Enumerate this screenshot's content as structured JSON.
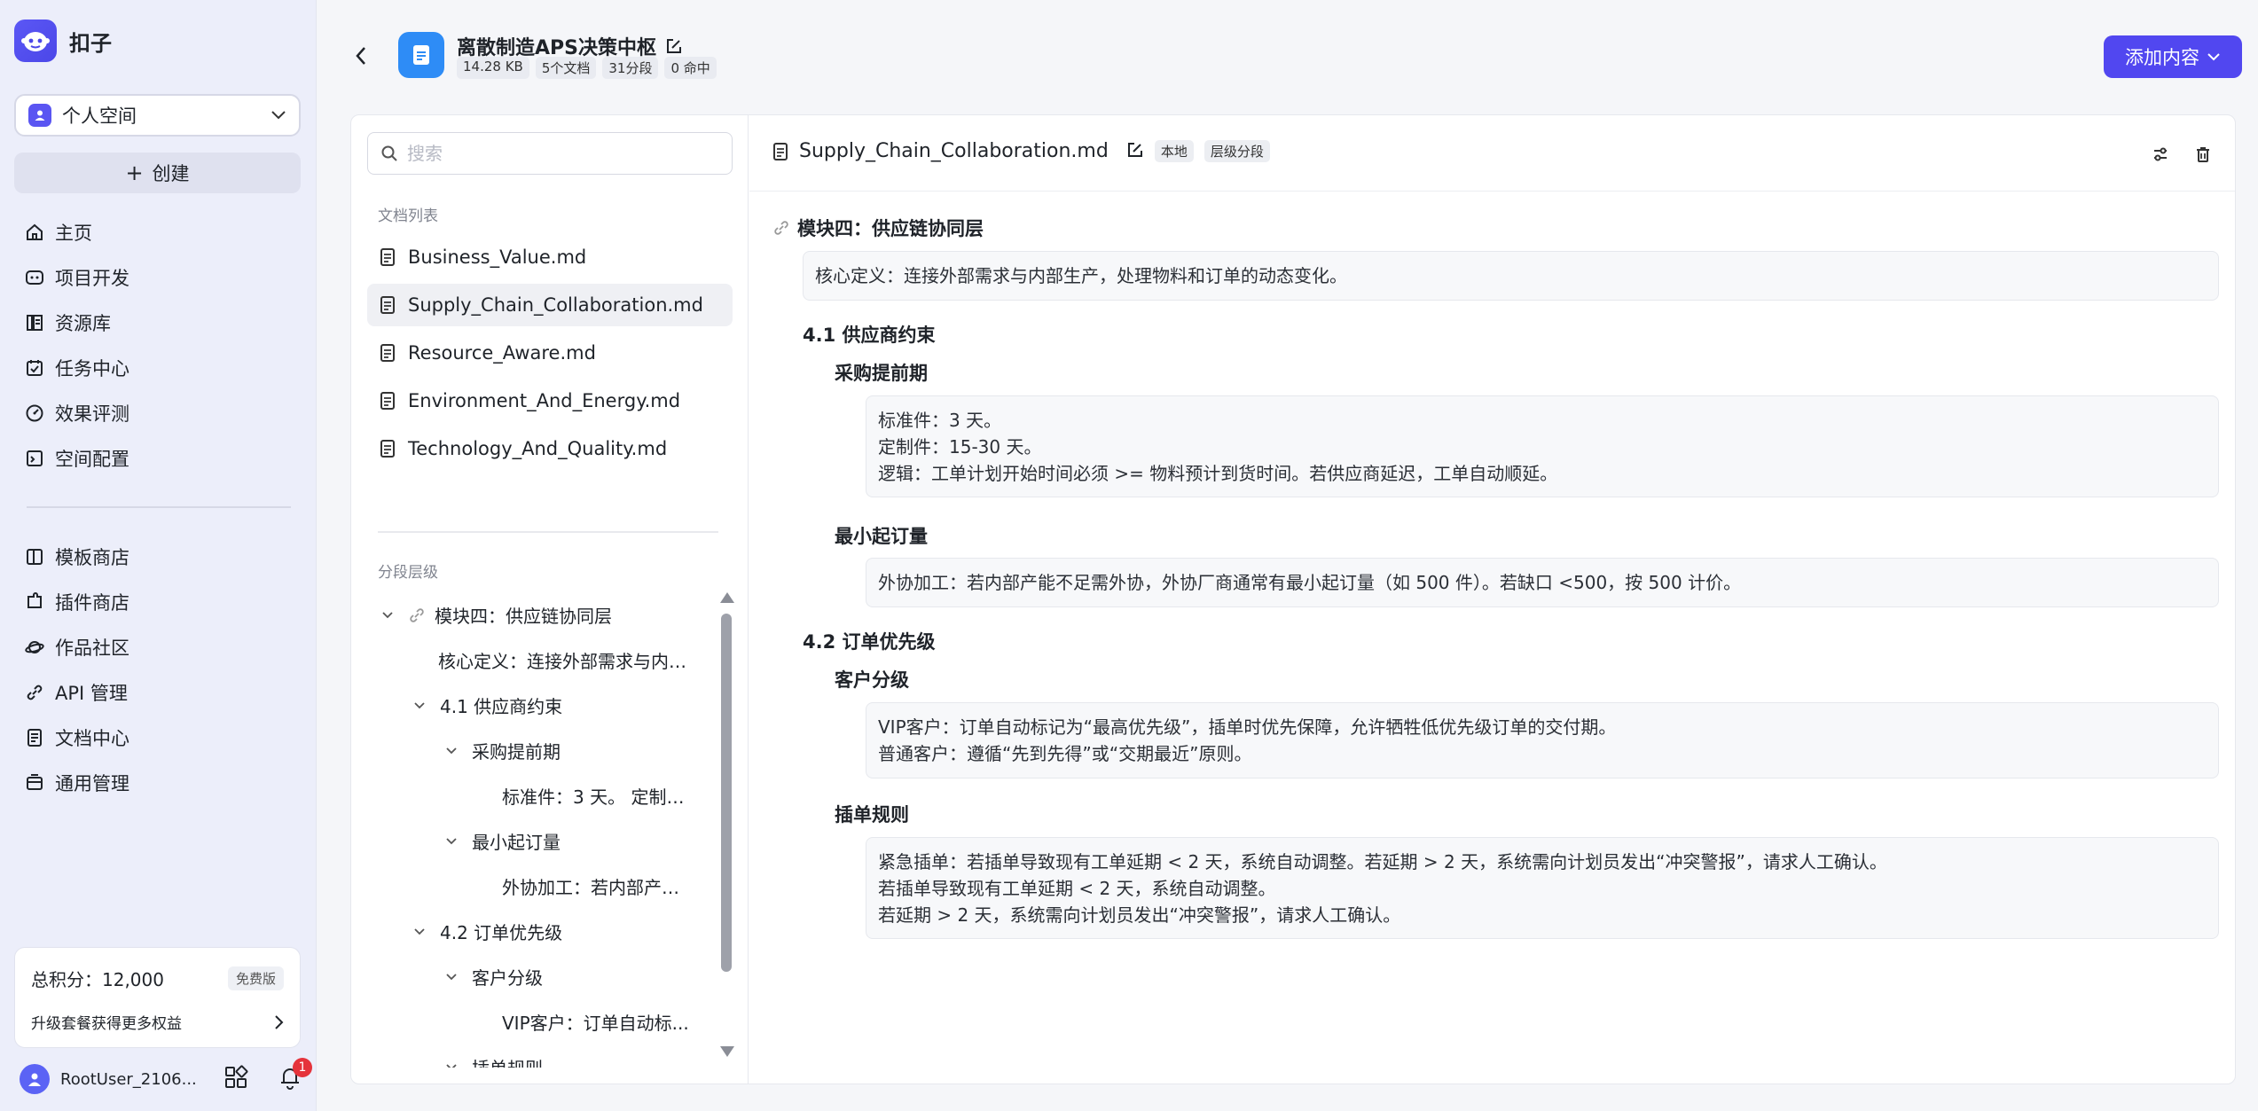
{
  "brand": {
    "name": "扣子"
  },
  "space": {
    "label": "个人空间"
  },
  "create": {
    "label": "创建"
  },
  "nav_primary": [
    {
      "icon": "home-icon",
      "label": "主页"
    },
    {
      "icon": "project-icon",
      "label": "项目开发"
    },
    {
      "icon": "library-icon",
      "label": "资源库"
    },
    {
      "icon": "task-icon",
      "label": "任务中心"
    },
    {
      "icon": "gauge-icon",
      "label": "效果评测"
    },
    {
      "icon": "settings-folder-icon",
      "label": "空间配置"
    }
  ],
  "nav_secondary": [
    {
      "icon": "template-icon",
      "label": "模板商店"
    },
    {
      "icon": "plugin-icon",
      "label": "插件商店"
    },
    {
      "icon": "planet-icon",
      "label": "作品社区"
    },
    {
      "icon": "api-icon",
      "label": "API 管理"
    },
    {
      "icon": "doc-center-icon",
      "label": "文档中心"
    },
    {
      "icon": "general-icon",
      "label": "通用管理"
    }
  ],
  "points": {
    "total_label": "总积分：12,000",
    "plan_badge": "免费版",
    "upgrade_text": "升级套餐获得更多权益"
  },
  "user": {
    "name": "RootUser_2106...",
    "notifications": "1"
  },
  "knowledge_base": {
    "title": "离散制造APS决策中枢",
    "meta": [
      "14.28 KB",
      "5个文档",
      "31分段",
      "0 命中"
    ],
    "add_button": "添加内容"
  },
  "search": {
    "placeholder": "搜索"
  },
  "doc_list": {
    "label": "文档列表",
    "items": [
      {
        "name": "Business_Value.md",
        "active": false
      },
      {
        "name": "Supply_Chain_Collaboration.md",
        "active": true
      },
      {
        "name": "Resource_Aware.md",
        "active": false
      },
      {
        "name": "Environment_And_Energy.md",
        "active": false
      },
      {
        "name": "Technology_And_Quality.md",
        "active": false
      }
    ]
  },
  "segment_tree": {
    "label": "分段层级",
    "rows": [
      {
        "level": 0,
        "expanded": true,
        "link": true,
        "text": "模块四：供应链协同层"
      },
      {
        "level": 1,
        "leaf": true,
        "text": "核心定义：连接外部需求与内部生产..."
      },
      {
        "level": 1,
        "expanded": true,
        "text": "4.1 供应商约束"
      },
      {
        "level": 2,
        "expanded": true,
        "text": "采购提前期"
      },
      {
        "level": 3,
        "leaf": true,
        "text": "标准件：3 天。 定制件..."
      },
      {
        "level": 2,
        "expanded": true,
        "text": "最小起订量"
      },
      {
        "level": 3,
        "leaf": true,
        "text": "外协加工：若内部产能..."
      },
      {
        "level": 1,
        "expanded": true,
        "text": "4.2 订单优先级"
      },
      {
        "level": 2,
        "expanded": true,
        "text": "客户分级"
      },
      {
        "level": 3,
        "leaf": true,
        "text": "VIP客户：订单自动标..."
      },
      {
        "level": 2,
        "expanded": true,
        "text": "插单规则"
      }
    ]
  },
  "document": {
    "name": "Supply_Chain_Collaboration.md",
    "tags": [
      "本地",
      "层级分段"
    ],
    "module_title": "模块四：供应链协同层",
    "core_definition": "核心定义：连接外部需求与内部生产，处理物料和订单的动态变化。",
    "sec_41": "4.1 供应商约束",
    "sub_lead": "采购提前期",
    "lead_lines": [
      "标准件：3 天。",
      "定制件：15-30 天。",
      "逻辑：工单计划开始时间必须 >= 物料预计到货时间。若供应商延迟，工单自动顺延。"
    ],
    "sub_moq": "最小起订量",
    "moq_text": "外协加工：若内部产能不足需外协，外协厂商通常有最小起订量（如 500 件）。若缺口 <500，按 500 计价。",
    "sec_42": "4.2 订单优先级",
    "sub_cust": "客户分级",
    "cust_lines": [
      "VIP客户：订单自动标记为“最高优先级”，插单时优先保障，允许牺牲低优先级订单的交付期。",
      "普通客户：遵循“先到先得”或“交期最近”原则。"
    ],
    "sub_insert": "插单规则",
    "insert_lines": [
      "紧急插单：若插单导致现有工单延期 < 2 天，系统自动调整。若延期 > 2 天，系统需向计划员发出“冲突警报”，请求人工确认。",
      "若插单导致现有工单延期 < 2 天，系统自动调整。",
      "若延期 > 2 天，系统需向计划员发出“冲突警报”，请求人工确认。"
    ]
  },
  "colors": {
    "accent": "#5147f0",
    "kb_icon": "#2e8cf6",
    "badge": "#e5333b"
  }
}
